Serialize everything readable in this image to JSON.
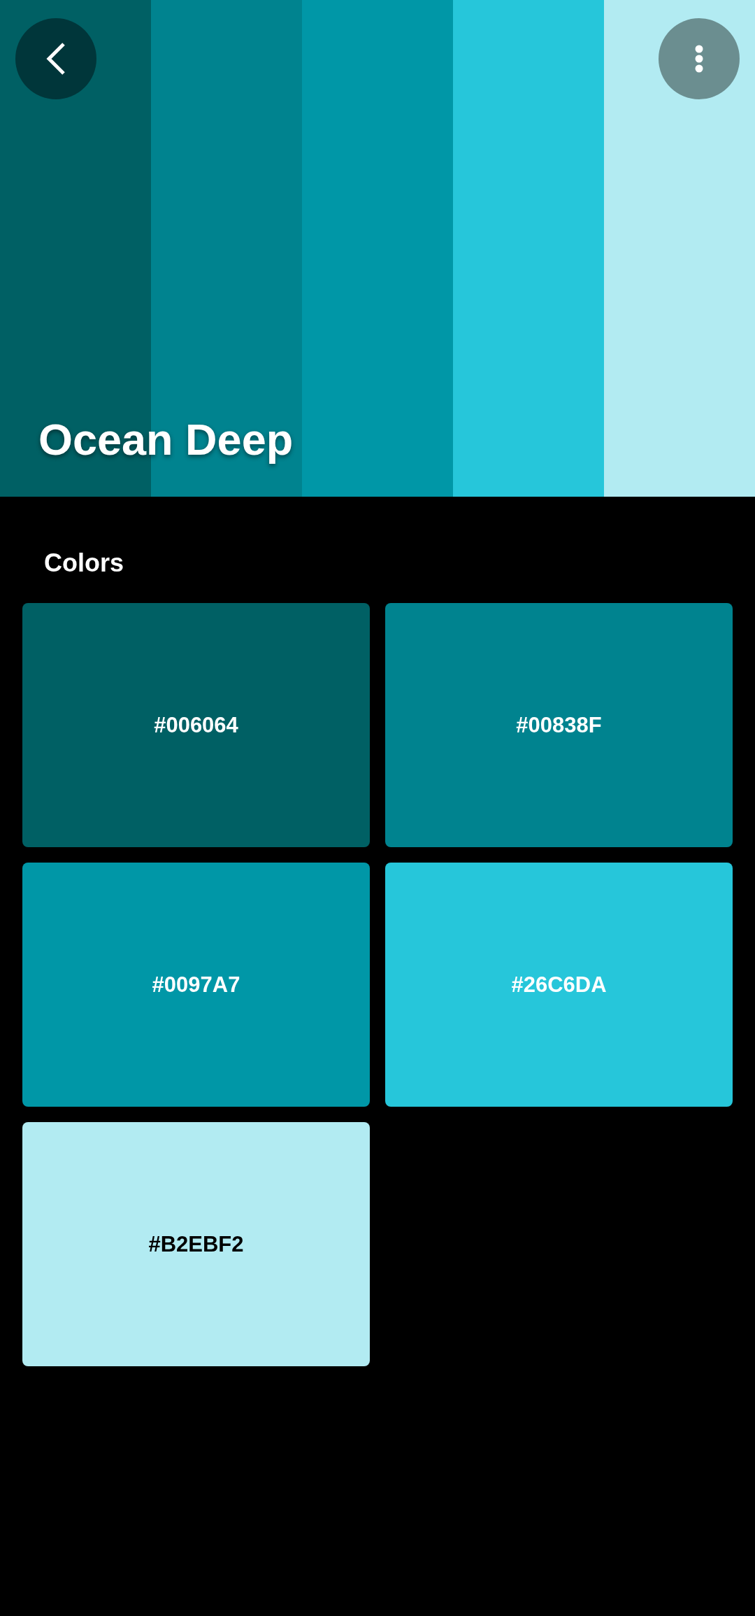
{
  "header": {
    "title": "Ocean Deep"
  },
  "section_title": "Colors",
  "colors": [
    {
      "hex": "#006064",
      "color": "#006064"
    },
    {
      "hex": "#00838F",
      "color": "#00838f"
    },
    {
      "hex": "#0097A7",
      "color": "#0097a7"
    },
    {
      "hex": "#26C6DA",
      "color": "#26c6da"
    },
    {
      "hex": "#B2EBF2",
      "color": "#b2ebf2"
    }
  ]
}
